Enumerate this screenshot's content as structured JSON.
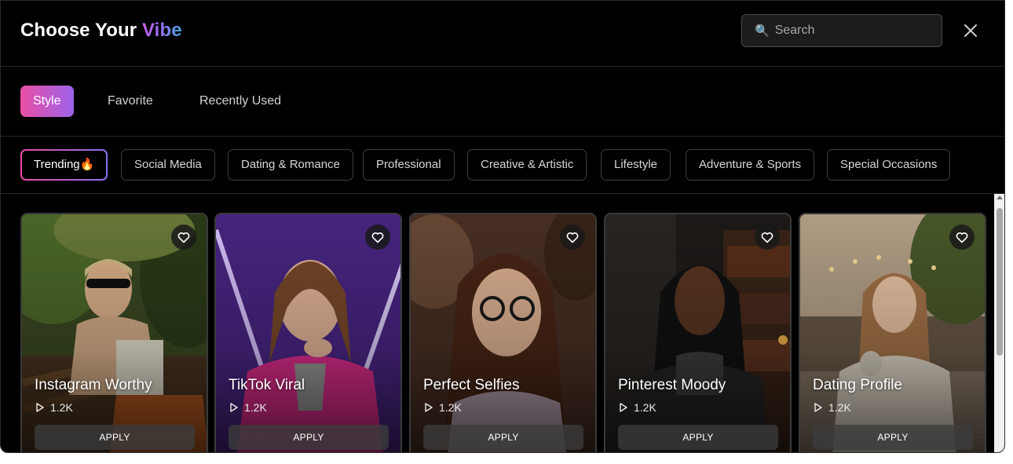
{
  "header": {
    "title_main": "Choose Your ",
    "title_accent": "Vibe",
    "search_placeholder": "Search",
    "search_icon": "magnifier-icon",
    "close_icon": "close-icon"
  },
  "tabs": [
    {
      "label": "Style",
      "active": true
    },
    {
      "label": "Favorite",
      "active": false
    },
    {
      "label": "Recently Used",
      "active": false
    }
  ],
  "categories": [
    {
      "label": "Trending🔥",
      "active": true
    },
    {
      "label": "Social Media",
      "active": false
    },
    {
      "label": "Dating & Romance",
      "active": false
    },
    {
      "label": "Professional",
      "active": false
    },
    {
      "label": "Creative & Artistic",
      "active": false
    },
    {
      "label": "Lifestyle",
      "active": false
    },
    {
      "label": "Adventure & Sports",
      "active": false
    },
    {
      "label": "Special Occasions",
      "active": false
    }
  ],
  "cards": [
    {
      "title": "Instagram Worthy",
      "uses": "1.2K",
      "action": "APPLY",
      "favorite_icon": "heart-outline-icon"
    },
    {
      "title": "TikTok Viral",
      "uses": "1.2K",
      "action": "APPLY",
      "favorite_icon": "heart-outline-icon"
    },
    {
      "title": "Perfect Selfies",
      "uses": "1.2K",
      "action": "APPLY",
      "favorite_icon": "heart-outline-icon"
    },
    {
      "title": "Pinterest Moody",
      "uses": "1.2K",
      "action": "APPLY",
      "favorite_icon": "heart-outline-icon"
    },
    {
      "title": "Dating Profile",
      "uses": "1.2K",
      "action": "APPLY",
      "favorite_icon": "heart-outline-icon"
    }
  ],
  "colors": {
    "background": "#000000",
    "accent_gradient_start": "#ea4fa5",
    "accent_gradient_end": "#9d62ea",
    "title_accent_start": "#c660ef",
    "title_accent_end": "#3fa9dd"
  }
}
